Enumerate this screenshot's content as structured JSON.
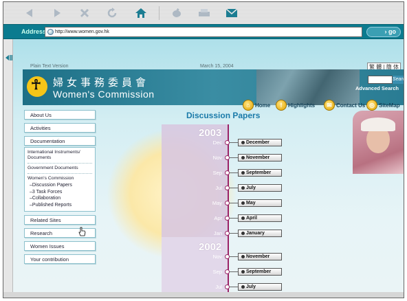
{
  "toolbar": {
    "buttons": [
      "back-icon",
      "forward-icon",
      "stop-icon",
      "refresh-icon",
      "home-icon",
      "edit-icon",
      "print-icon",
      "mail-icon"
    ]
  },
  "address_bar": {
    "label": "Address",
    "url": "http://www.women.gov.hk",
    "go_label": "go"
  },
  "header": {
    "plain_text": "Plain Text Version",
    "date": "March 15, 2004",
    "language": "繁 體 | 簡 体",
    "title_zh": "婦女事務委員會",
    "title_en": "Women's Commission",
    "search_button": "Search",
    "advanced_search": "Advanced Search"
  },
  "nav": {
    "items": [
      "Home",
      "Highlights",
      "Contact Us",
      "SiteMap"
    ]
  },
  "page_title": "Discussion Papers",
  "menu": {
    "items_top": [
      "About Us",
      "Activities",
      "Documentation"
    ],
    "doc_links": [
      "International Instruments/ Documents",
      "Government Documents"
    ],
    "doc_section": "Women's Commission",
    "doc_sub": [
      "Discussion Papers",
      "3 Task Forces",
      "Collaboration",
      "Published Reports"
    ],
    "items_bottom": [
      "Related Sites",
      "Research",
      "Women Issues",
      "Your contribution"
    ]
  },
  "timeline": {
    "year1": "2003",
    "year1_entries": [
      {
        "short": "Dec",
        "label": "December"
      },
      {
        "short": "Nov",
        "label": "November"
      },
      {
        "short": "Sep",
        "label": "September"
      },
      {
        "short": "Jul",
        "label": "July"
      },
      {
        "short": "May",
        "label": "May"
      },
      {
        "short": "Apr",
        "label": "April"
      },
      {
        "short": "Jan",
        "label": "January"
      }
    ],
    "year2": "2002",
    "year2_entries": [
      {
        "short": "Nov",
        "label": "November"
      },
      {
        "short": "Sep",
        "label": "September"
      },
      {
        "short": "Jul",
        "label": "July"
      }
    ]
  },
  "colors": {
    "address_bar": "#0b7b8f",
    "heading": "#1a7aa9",
    "timeline": "#9a2266"
  }
}
